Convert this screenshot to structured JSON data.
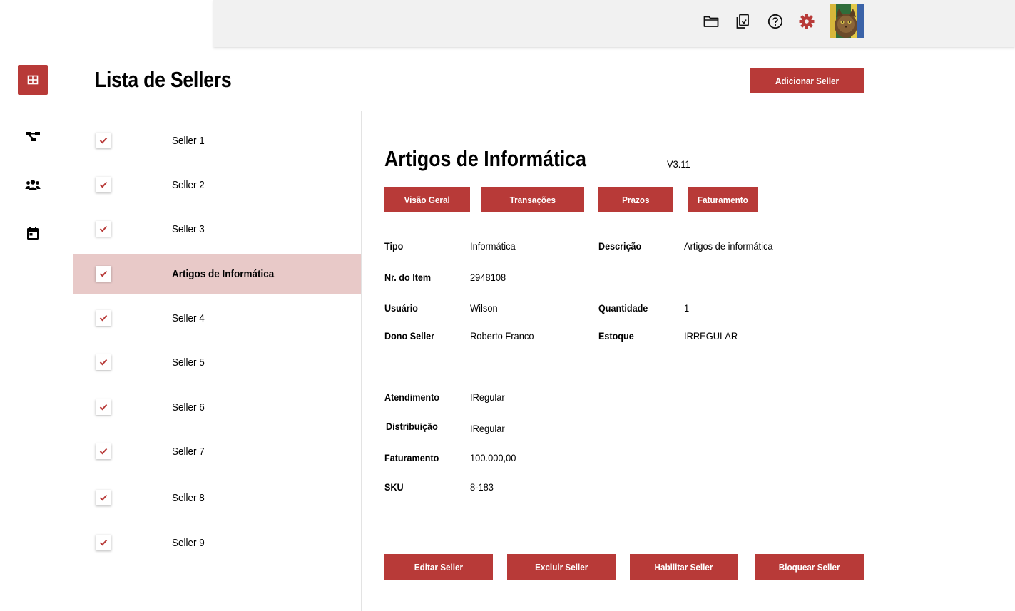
{
  "nav": {
    "items": [
      {
        "icon": "grid-icon",
        "active": true
      },
      {
        "icon": "share-nodes-icon",
        "active": false
      },
      {
        "icon": "users-icon",
        "active": false
      },
      {
        "icon": "calendar-icon",
        "active": false
      }
    ]
  },
  "topbar": {
    "icons": [
      "folder-icon",
      "document-copy-icon",
      "help-icon",
      "settings-icon"
    ],
    "accent": "#b83a38"
  },
  "page": {
    "title": "Lista de Sellers",
    "add_button": "Adicionar Seller"
  },
  "sellers": [
    {
      "name": "Seller 1",
      "checked": true,
      "selected": false
    },
    {
      "name": "Seller 2",
      "checked": true,
      "selected": false
    },
    {
      "name": "Seller 3",
      "checked": true,
      "selected": false
    },
    {
      "name": "Artigos de Informática",
      "checked": true,
      "selected": true
    },
    {
      "name": "Seller 4",
      "checked": true,
      "selected": false
    },
    {
      "name": "Seller 5",
      "checked": true,
      "selected": false
    },
    {
      "name": "Seller 6",
      "checked": true,
      "selected": false
    },
    {
      "name": "Seller 7",
      "checked": true,
      "selected": false
    },
    {
      "name": "Seller 8",
      "checked": true,
      "selected": false
    },
    {
      "name": "Seller 9",
      "checked": true,
      "selected": false
    }
  ],
  "detail": {
    "title": "Artigos de Informática",
    "version": "V3.11",
    "tabs": [
      "Visão Geral",
      "Transações",
      "Prazos",
      "Faturamento"
    ],
    "fields": {
      "tipo": {
        "label": "Tipo",
        "value": "Informática"
      },
      "descricao": {
        "label": "Descrição",
        "value": "Artigos de informática"
      },
      "nr_item": {
        "label": "Nr. do Item",
        "value": "2948108"
      },
      "usuario": {
        "label": "Usuário",
        "value": "Wilson"
      },
      "quantidade": {
        "label": "Quantidade",
        "value": "1"
      },
      "dono": {
        "label": "Dono Seller",
        "value": "Roberto Franco"
      },
      "estoque": {
        "label": "Estoque",
        "value": "IRREGULAR"
      },
      "atendimento": {
        "label": "Atendimento",
        "value": "IRegular"
      },
      "distribuicao": {
        "label": "Distribuição",
        "value": "IRegular"
      },
      "faturamento": {
        "label": "Faturamento",
        "value": "100.000,00"
      },
      "sku": {
        "label": "SKU",
        "value": "8-183"
      }
    },
    "actions": [
      "Editar Seller",
      "Excluir Seller",
      "Habilitar Seller",
      "Bloquear Seller"
    ]
  },
  "colors": {
    "primary": "#b83a38",
    "selected_row": "#e8c9c8",
    "topbar_bg": "#f1f1f1"
  }
}
